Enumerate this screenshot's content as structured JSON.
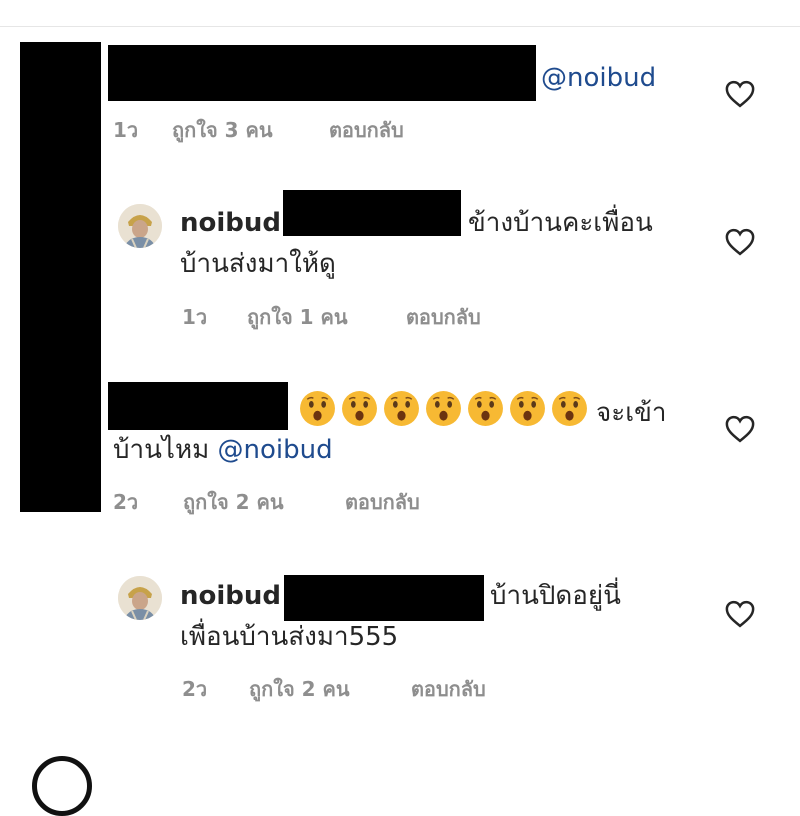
{
  "comments": [
    {
      "mention": "@noibud",
      "time": "1ว",
      "likes": "ถูกใจ 3 คน",
      "reply": "ตอบกลับ",
      "like_icon": "heart-outline-icon"
    },
    {
      "username": "noibud",
      "text_line1": "ข้างบ้านคะเพื่อน",
      "text_line2": "บ้านส่งมาให้ดู",
      "time": "1ว",
      "likes": "ถูกใจ 1 คน",
      "reply": "ตอบกลับ",
      "like_icon": "heart-outline-icon"
    },
    {
      "emoji": [
        "hushed-face-emoji",
        "hushed-face-emoji",
        "hushed-face-emoji",
        "hushed-face-emoji",
        "hushed-face-emoji",
        "hushed-face-emoji",
        "hushed-face-emoji"
      ],
      "text_line1_end": "จะเข้า",
      "text_line2": "บ้านไหม",
      "mention": "@noibud",
      "time": "2ว",
      "likes": "ถูกใจ 2 คน",
      "reply": "ตอบกลับ",
      "like_icon": "heart-outline-icon"
    },
    {
      "username": "noibud",
      "text_line1": "บ้านปิดอยู่นี่",
      "text_line2": "เพื่อนบ้านส่งมา555",
      "time": "2ว",
      "likes": "ถูกใจ 2 คน",
      "reply": "ตอบกลับ",
      "like_icon": "heart-outline-icon"
    }
  ],
  "colors": {
    "mention": "#1f4b8e",
    "meta": "#8e8e8e",
    "text": "#262626",
    "emoji": "#f7b933"
  }
}
